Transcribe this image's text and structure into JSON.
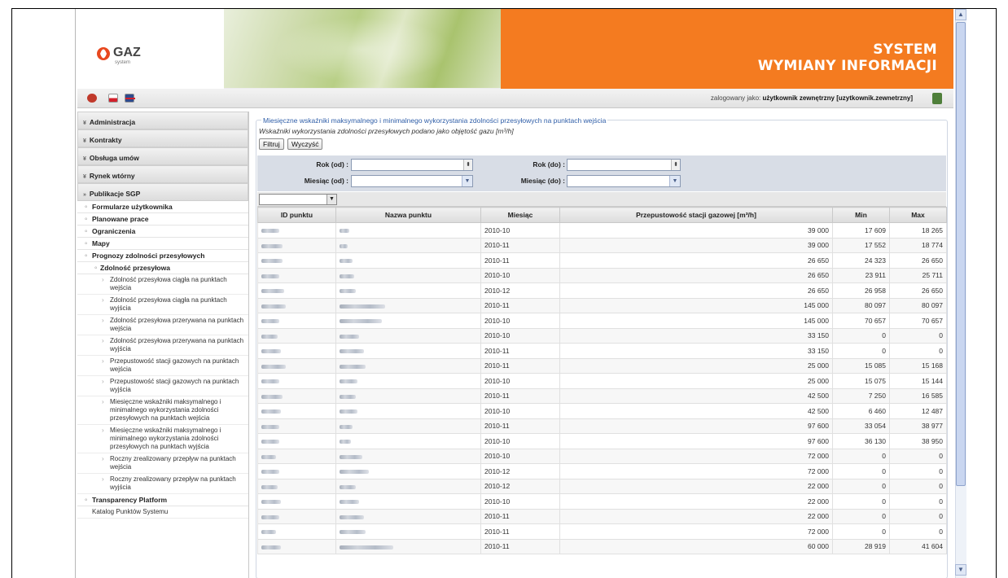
{
  "header": {
    "brand_main": "GAZ",
    "brand_sub": "system",
    "title_line1": "SYSTEM",
    "title_line2": "WYMIANY INFORMACJI"
  },
  "topbar": {
    "login_label": "zalogowany jako:",
    "login_user": "użytkownik zewnętrzny [uzytkownik.zewnetrzny]"
  },
  "sidebar": {
    "sections": [
      {
        "label": "Administracja",
        "chevron": "»"
      },
      {
        "label": "Kontrakty",
        "chevron": "»"
      },
      {
        "label": "Obsługa umów",
        "chevron": "»"
      },
      {
        "label": "Rynek wtórny",
        "chevron": "»"
      },
      {
        "label": "Publikacje SGP",
        "chevron": "»"
      }
    ],
    "subitems": [
      "Formularze użytkownika",
      "Planowane prace",
      "Ograniczenia",
      "Mapy",
      "Prognozy zdolności przesyłowych",
      "Zdolność przesyłowa"
    ],
    "leaves": [
      "Zdolność przesyłowa ciągła na punktach wejścia",
      "Zdolność przesyłowa ciągła na punktach wyjścia",
      "Zdolność przesyłowa przerywana na punktach wejścia",
      "Zdolność przesyłowa przerywana na punktach wyjścia",
      "Przepustowość stacji gazowych na punktach wejścia",
      "Przepustowość stacji gazowych na punktach wyjścia",
      "Miesięczne wskaźniki maksymalnego i minimalnego wykorzystania zdolności przesyłowych na punktach wejścia",
      "Miesięczne wskaźniki maksymalnego i minimalnego wykorzystania zdolności przesyłowych na punktach wyjścia",
      "Roczny zrealizowany przepływ na punktach wejścia",
      "Roczny zrealizowany przepływ na punktach wyjścia"
    ],
    "tail_sub": "Transparency Platform",
    "tail_leaf": "Katalog Punktów Systemu"
  },
  "content": {
    "legend": "Miesięczne wskaźniki maksymalnego i minimalnego wykorzystania zdolności przesyłowych na punktach wejścia",
    "subtitle": "Wskaźniki wykorzystania zdolności przesyłowych podano jako objętość gazu [m³/h]",
    "filter_button": "Filtruj",
    "clear_button": "Wyczyść",
    "filters": {
      "year_from_label": "Rok (od) :",
      "year_to_label": "Rok (do) :",
      "month_from_label": "Miesiąc (od) :",
      "month_to_label": "Miesiąc (do) :"
    },
    "columns": [
      "ID punktu",
      "Nazwa punktu",
      "Miesiąc",
      "Przepustowość stacji gazowej [m³/h]",
      "Min",
      "Max"
    ],
    "rows": [
      [
        "2010-10",
        "39 000",
        "17 609",
        "18 265"
      ],
      [
        "2010-11",
        "39 000",
        "17 552",
        "18 774"
      ],
      [
        "2010-11",
        "26 650",
        "24 323",
        "26 650"
      ],
      [
        "2010-10",
        "26 650",
        "23 911",
        "25 711"
      ],
      [
        "2010-12",
        "26 650",
        "26 958",
        "26 650"
      ],
      [
        "2010-11",
        "145 000",
        "80 097",
        "80 097"
      ],
      [
        "2010-10",
        "145 000",
        "70 657",
        "70 657"
      ],
      [
        "2010-10",
        "33 150",
        "0",
        "0"
      ],
      [
        "2010-11",
        "33 150",
        "0",
        "0"
      ],
      [
        "2010-11",
        "25 000",
        "15 085",
        "15 168"
      ],
      [
        "2010-10",
        "25 000",
        "15 075",
        "15 144"
      ],
      [
        "2010-11",
        "42 500",
        "7 250",
        "16 585"
      ],
      [
        "2010-10",
        "42 500",
        "6 460",
        "12 487"
      ],
      [
        "2010-11",
        "97 600",
        "33 054",
        "38 977"
      ],
      [
        "2010-10",
        "97 600",
        "36 130",
        "38 950"
      ],
      [
        "2010-10",
        "72 000",
        "0",
        "0"
      ],
      [
        "2010-12",
        "72 000",
        "0",
        "0"
      ],
      [
        "2010-12",
        "22 000",
        "0",
        "0"
      ],
      [
        "2010-10",
        "22 000",
        "0",
        "0"
      ],
      [
        "2010-11",
        "22 000",
        "0",
        "0"
      ],
      [
        "2010-11",
        "72 000",
        "0",
        "0"
      ],
      [
        "2010-11",
        "60 000",
        "28 919",
        "41 604"
      ]
    ]
  }
}
